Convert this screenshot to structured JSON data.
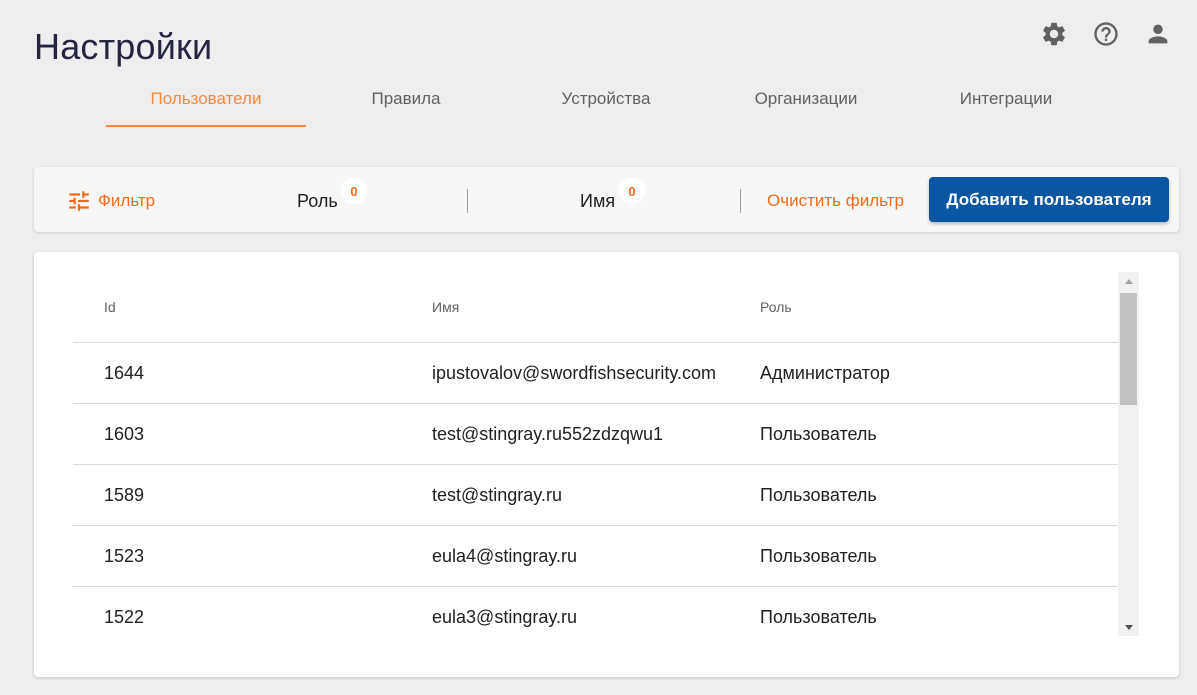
{
  "header": {
    "title": "Настройки",
    "icons": [
      "gear-icon",
      "help-icon",
      "user-icon"
    ]
  },
  "tabs": [
    {
      "label": "Пользователи",
      "active": true
    },
    {
      "label": "Правила",
      "active": false
    },
    {
      "label": "Устройства",
      "active": false
    },
    {
      "label": "Организации",
      "active": false
    },
    {
      "label": "Интеграции",
      "active": false
    }
  ],
  "filter_bar": {
    "filter_label": "Фильтр",
    "role_label": "Роль",
    "role_count": "0",
    "name_label": "Имя",
    "name_count": "0",
    "clear_label": "Очистить фильтр",
    "add_user_label": "Добавить пользователя"
  },
  "table": {
    "columns": [
      "Id",
      "Имя",
      "Роль"
    ],
    "rows": [
      {
        "id": "1644",
        "name": "ipustovalov@swordfishsecurity.com",
        "role": "Администратор"
      },
      {
        "id": "1603",
        "name": "test@stingray.ru552zdzqwu1",
        "role": "Пользователь"
      },
      {
        "id": "1589",
        "name": "test@stingray.ru",
        "role": "Пользователь"
      },
      {
        "id": "1523",
        "name": "eula4@stingray.ru",
        "role": "Пользователь"
      },
      {
        "id": "1522",
        "name": "eula3@stingray.ru",
        "role": "Пользователь"
      }
    ]
  },
  "colors": {
    "accent": "#f26b1d",
    "tab_active": "#f58a3d",
    "primary_button": "#0a56a3",
    "title": "#252541"
  }
}
